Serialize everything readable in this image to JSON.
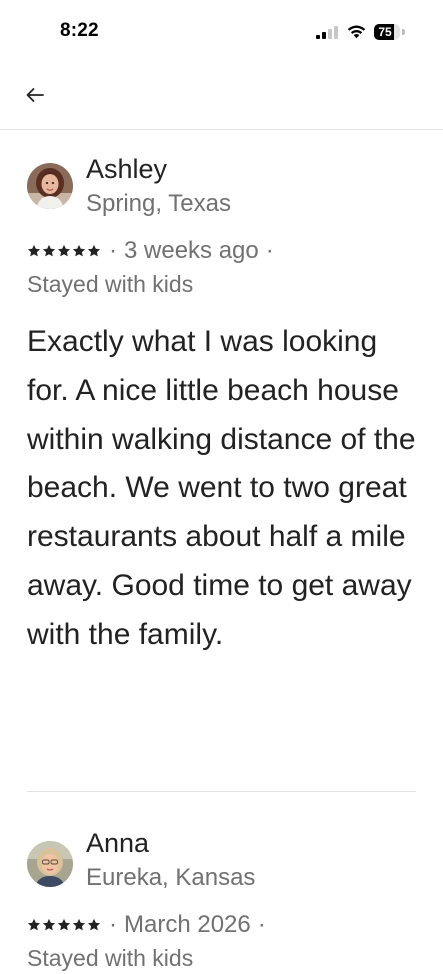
{
  "status_bar": {
    "time": "8:22",
    "battery_level": "75",
    "battery_fraction": 0.75
  },
  "header": {
    "back_icon": "arrow-left-icon"
  },
  "reviews": [
    {
      "name": "Ashley",
      "location": "Spring, Texas",
      "rating": 5,
      "date": "3 weeks ago",
      "trip_type": "Stayed with kids",
      "text": "Exactly what I was looking for. A nice little beach house within walking distance of the beach. We went to two great restaurants about half a mile away. Good time to get away with the family."
    },
    {
      "name": "Anna",
      "location": "Eureka, Kansas",
      "rating": 5,
      "date": "March 2026",
      "trip_type": "Stayed with kids"
    }
  ],
  "colors": {
    "text_primary": "#222222",
    "text_secondary": "#717171",
    "divider": "#e4e4e4"
  }
}
